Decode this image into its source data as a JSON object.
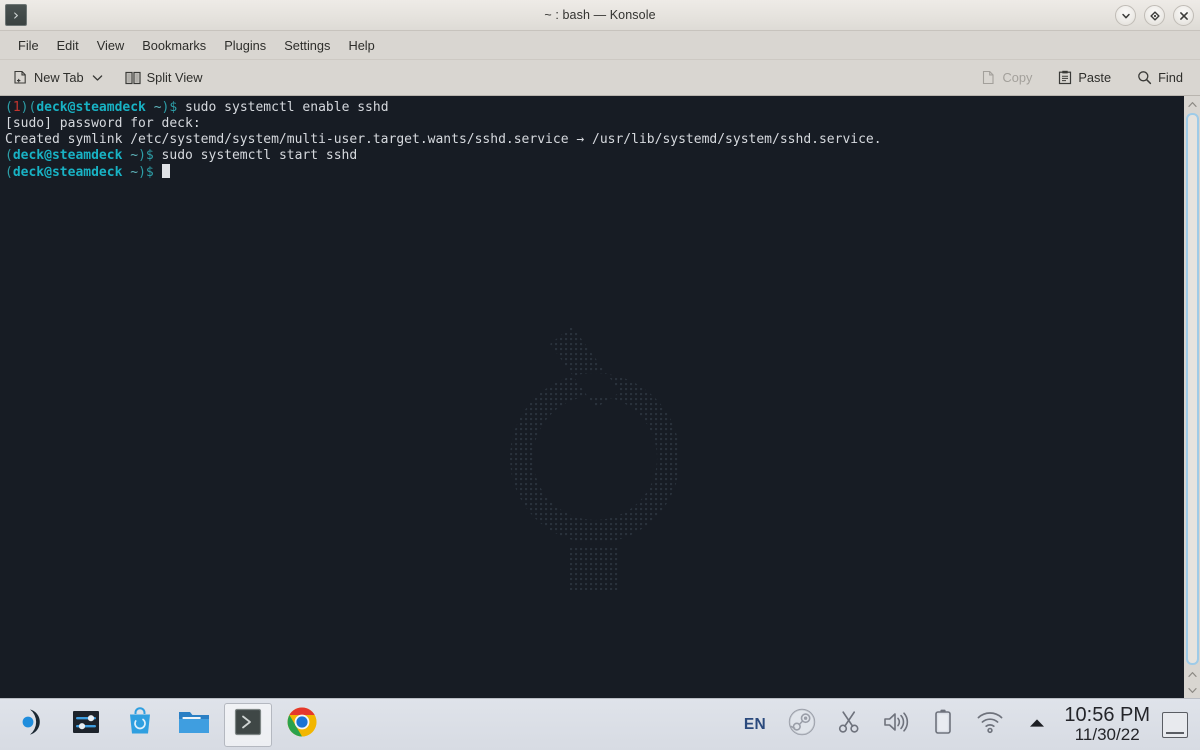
{
  "window": {
    "title": "~ : bash — Konsole",
    "icon": "konsole-prompt-icon",
    "controls": [
      {
        "name": "minimize-button",
        "glyph": "chevron-down-icon"
      },
      {
        "name": "maximize-button",
        "glyph": "diamond-icon"
      },
      {
        "name": "close-button",
        "glyph": "close-x-icon"
      }
    ]
  },
  "menubar": {
    "items": [
      {
        "label": "File"
      },
      {
        "label": "Edit"
      },
      {
        "label": "View"
      },
      {
        "label": "Bookmarks"
      },
      {
        "label": "Plugins"
      },
      {
        "label": "Settings"
      },
      {
        "label": "Help"
      }
    ]
  },
  "toolbar": {
    "new_tab_label": "New Tab",
    "split_view_label": "Split View",
    "copy_label": "Copy",
    "copy_enabled": false,
    "paste_label": "Paste",
    "find_label": "Find"
  },
  "terminal": {
    "lines": [
      {
        "segments": [
          {
            "text": "(",
            "color": "paren"
          },
          {
            "text": "1",
            "color": "err"
          },
          {
            "text": ")(",
            "color": "paren"
          },
          {
            "text": "deck@steamdeck",
            "color": "host"
          },
          {
            "text": " ",
            "color": "plain"
          },
          {
            "text": "~",
            "color": "tilde"
          },
          {
            "text": ")$",
            "color": "paren"
          },
          {
            "text": " sudo systemctl enable sshd",
            "color": "plain"
          }
        ]
      },
      {
        "segments": [
          {
            "text": "[sudo] password for deck:",
            "color": "plain"
          }
        ]
      },
      {
        "segments": [
          {
            "text": "Created symlink /etc/systemd/system/multi-user.target.wants/sshd.service → /usr/lib/systemd/system/sshd.service.",
            "color": "plain"
          }
        ]
      },
      {
        "segments": [
          {
            "text": "(",
            "color": "paren"
          },
          {
            "text": "deck@steamdeck",
            "color": "host"
          },
          {
            "text": " ",
            "color": "plain"
          },
          {
            "text": "~",
            "color": "tilde"
          },
          {
            "text": ")$",
            "color": "paren"
          },
          {
            "text": " sudo systemctl start sshd",
            "color": "plain"
          }
        ]
      },
      {
        "segments": [
          {
            "text": "(",
            "color": "paren"
          },
          {
            "text": "deck@steamdeck",
            "color": "host"
          },
          {
            "text": " ",
            "color": "plain"
          },
          {
            "text": "~",
            "color": "tilde"
          },
          {
            "text": ")$",
            "color": "paren"
          },
          {
            "text": " ",
            "color": "plain"
          }
        ],
        "cursor": true
      }
    ],
    "colors": {
      "background": "#171c24",
      "foreground": "#d6d9de",
      "prompt_paren": "#2d9fa8",
      "prompt_host": "#18b2c4",
      "error_code": "#c4352f",
      "cursor": "#dfe2e6"
    }
  },
  "taskbar": {
    "tasks": [
      {
        "name": "taskbar-item-launcher",
        "icon": "kde-launcher-icon"
      },
      {
        "name": "taskbar-item-settings",
        "icon": "system-settings-icon"
      },
      {
        "name": "taskbar-item-discover",
        "icon": "discover-store-icon"
      },
      {
        "name": "taskbar-item-files",
        "icon": "file-manager-icon"
      },
      {
        "name": "taskbar-item-konsole",
        "icon": "konsole-icon",
        "active": true
      },
      {
        "name": "taskbar-item-chrome",
        "icon": "chrome-icon"
      }
    ],
    "tray": [
      {
        "name": "tray-keyboard-layout",
        "label": "EN"
      },
      {
        "name": "tray-steam-icon",
        "icon": "steam-icon"
      },
      {
        "name": "tray-clipboard-icon",
        "icon": "scissors-icon"
      },
      {
        "name": "tray-volume-icon",
        "icon": "speaker-icon"
      },
      {
        "name": "tray-battery-icon",
        "icon": "battery-icon"
      },
      {
        "name": "tray-network-icon",
        "icon": "wifi-icon"
      },
      {
        "name": "tray-expand-icon",
        "icon": "triangle-up-icon"
      }
    ],
    "clock": {
      "time": "10:56 PM",
      "date": "11/30/22"
    },
    "show_desktop": "show-desktop-button"
  }
}
